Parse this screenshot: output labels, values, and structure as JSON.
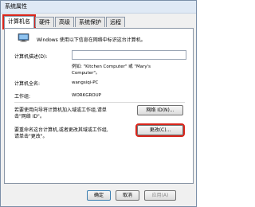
{
  "window": {
    "title": "系统属性"
  },
  "tabs": [
    {
      "label": "计算机名"
    },
    {
      "label": "硬件"
    },
    {
      "label": "高级"
    },
    {
      "label": "系统保护"
    },
    {
      "label": "远程"
    }
  ],
  "intro": "Windows 使用以下信息在网络中标识这台计算机。",
  "description": {
    "label": "计算机描述(D):",
    "value": "",
    "hint_line1": "例如: \"Kitchen Computer\" 或 \"Mary's",
    "hint_line2": "Computer\"。"
  },
  "full_name": {
    "label": "计算机全名:",
    "value": "wangsiqi-PC"
  },
  "workgroup": {
    "label": "工作组:",
    "value": "WORKGROUP"
  },
  "network_id": {
    "text_line1": "若要使用向导将计算机加入域或工作组,请单",
    "text_line2": "击\"网络 ID\"。",
    "button": "网络 ID(N)..."
  },
  "rename": {
    "text_line1": "要重命名这台计算机,或者更改其域或工作组,",
    "text_line2": "请单击\"更改\"。",
    "button": "更改(C)..."
  },
  "footer": {
    "ok": "确定",
    "cancel": "取消",
    "apply": "应用(A)"
  },
  "colors": {
    "highlight": "#d9251b",
    "title_bg": "#dfe9f5"
  }
}
